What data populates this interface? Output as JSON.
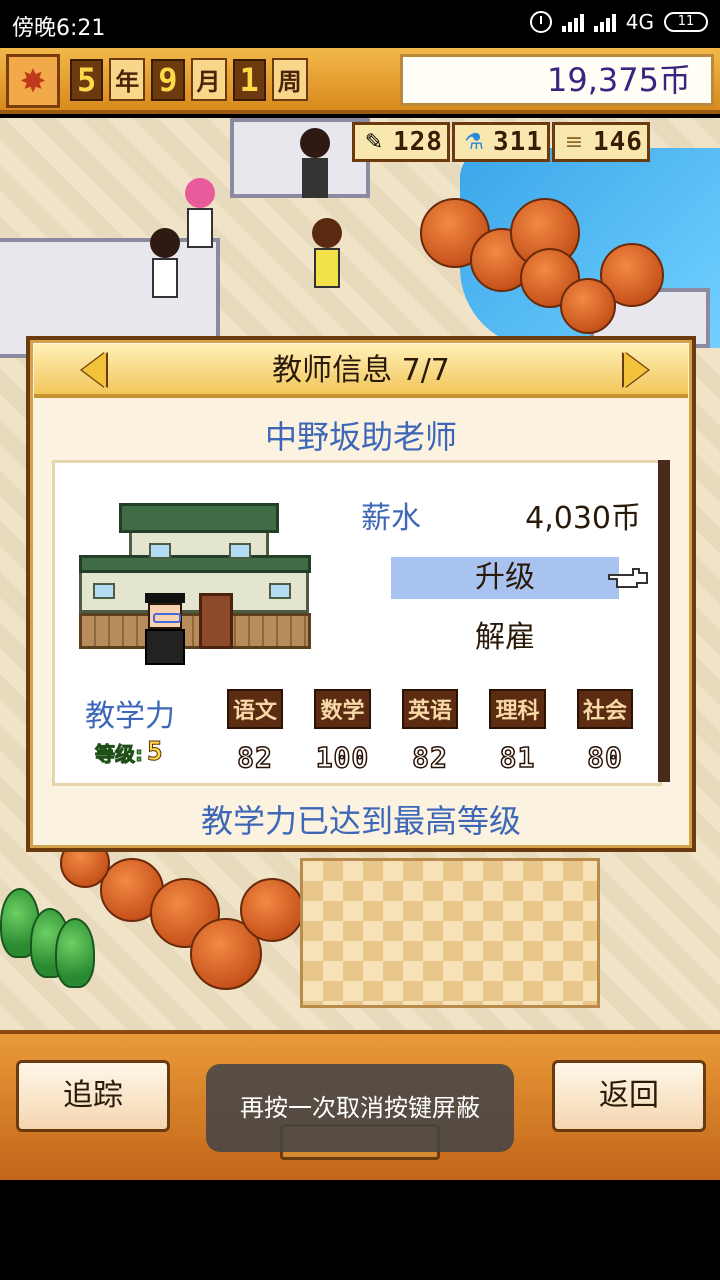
{
  "status_bar": {
    "time": "傍晚6:21",
    "network": "4G",
    "battery": "11"
  },
  "top_bar": {
    "year_num": "5",
    "year_unit": "年",
    "month_num": "9",
    "month_unit": "月",
    "week_num": "1",
    "week_unit": "周",
    "money": "19,375币"
  },
  "resources": {
    "pencil": "128",
    "flask": "311",
    "book": "146"
  },
  "dialog": {
    "title": "教师信息 7/7",
    "teacher_name": "中野坂助老师",
    "salary_label": "薪水",
    "salary_value": "4,030币",
    "upgrade_label": "升级",
    "fire_label": "解雇",
    "teaching_power_label": "教学力",
    "level_label": "等级:",
    "level_value": "5",
    "subjects": [
      {
        "name": "语文",
        "value": "82"
      },
      {
        "name": "数学",
        "value": "100"
      },
      {
        "name": "英语",
        "value": "82"
      },
      {
        "name": "理科",
        "value": "81"
      },
      {
        "name": "社会",
        "value": "80"
      }
    ],
    "max_note": "教学力已达到最高等级"
  },
  "bottom_bar": {
    "track_label": "追踪",
    "back_label": "返回"
  },
  "toast": "再按一次取消按键屏蔽",
  "colors": {
    "accent_blue": "#3e67b8",
    "highlight": "#a9c3f0",
    "frame_brown": "#6b3a0e"
  }
}
